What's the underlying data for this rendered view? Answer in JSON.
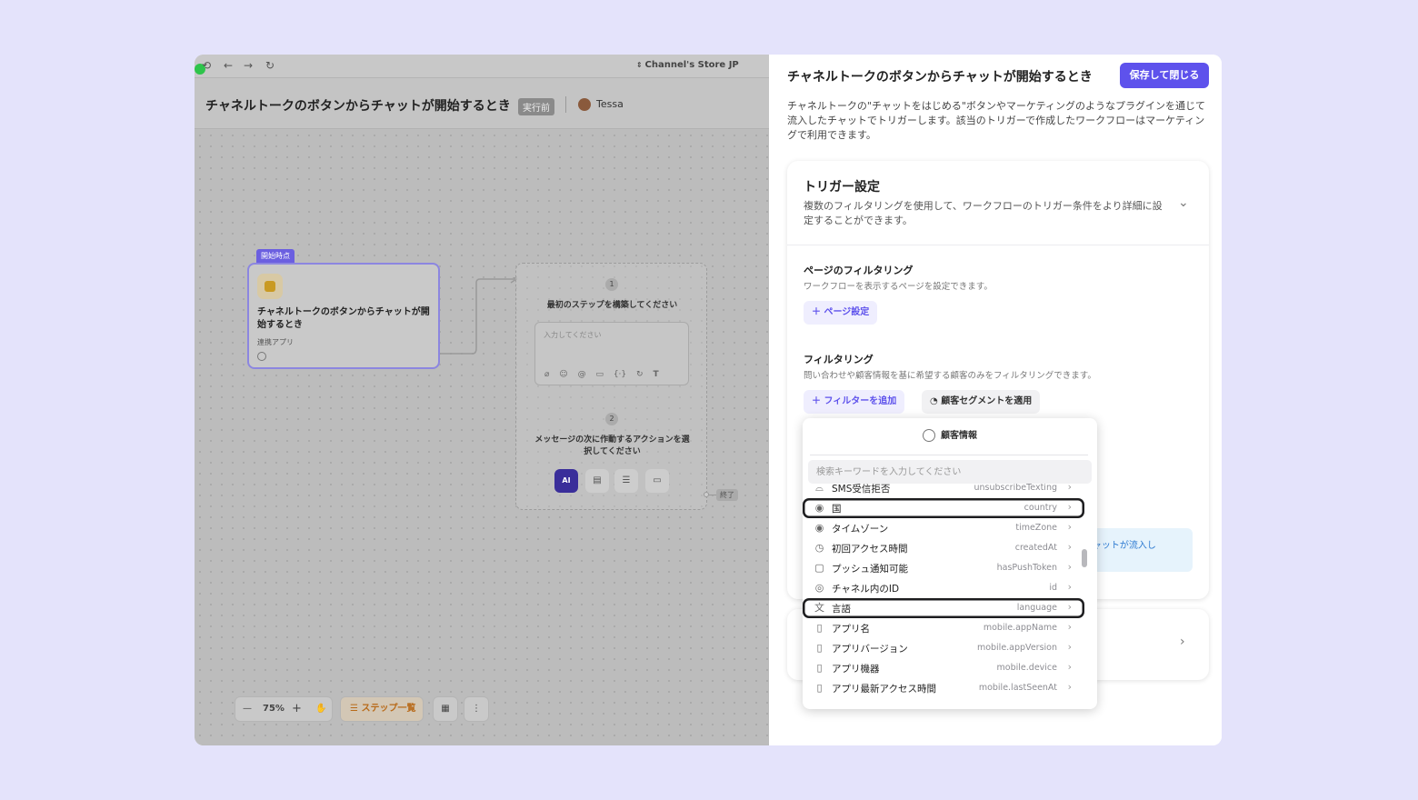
{
  "browser": {
    "store_name": "Channel's Store JP"
  },
  "workflow": {
    "title": "チャネルトークのボタンからチャットが開始するとき",
    "status_badge": "実行前",
    "user_name": "Tessa"
  },
  "canvas": {
    "start_tag": "開始時点",
    "trigger_card": {
      "title": "チャネルトークのボタンからチャットが開始するとき",
      "subtitle": "連携アプリ"
    },
    "step1": {
      "number": "1",
      "title": "最初のステップを構築してください",
      "placeholder": "入力してください"
    },
    "step2": {
      "number": "2",
      "title": "メッセージの次に作動するアクションを選択してください",
      "ai_label": "AI"
    },
    "end_tag": "終了",
    "zoom": "75%",
    "steps_button": "ステップ一覧"
  },
  "panel": {
    "title": "チャネルトークのボタンからチャットが開始するとき",
    "save_button": "保存して閉じる",
    "description": "チャネルトークの\"チャットをはじめる\"ボタンやマーケティングのようなプラグインを通じて流入したチャットでトリガーします。該当のトリガーで作成したワークフローはマーケティングで利用できます。",
    "trigger": {
      "heading": "トリガー設定",
      "subtitle": "複数のフィルタリングを使用して、ワークフローのトリガー条件をより詳細に設定することができます。"
    },
    "page_filter": {
      "title": "ページのフィルタリング",
      "subtitle": "ワークフローを表示するページを設定できます。",
      "button": "ページ設定"
    },
    "filtering": {
      "title": "フィルタリング",
      "subtitle": "問い合わせや顧客情報を基に希望する顧客のみをフィルタリングできます。",
      "add_button": "フィルターを追加",
      "segment_button": "顧客セグメントを適用"
    },
    "info_text": "チャットが流入し"
  },
  "dropdown": {
    "header": "顧客情報",
    "search_placeholder": "検索キーワードを入力してください",
    "items": [
      {
        "label": "SMS受信拒否",
        "key": "unsubscribeTexting",
        "icon": "chat-icon"
      },
      {
        "label": "国",
        "key": "country",
        "icon": "pin-icon"
      },
      {
        "label": "タイムゾーン",
        "key": "timeZone",
        "icon": "pin-icon"
      },
      {
        "label": "初回アクセス時間",
        "key": "createdAt",
        "icon": "clock-icon"
      },
      {
        "label": "プッシュ通知可能",
        "key": "hasPushToken",
        "icon": "push-icon"
      },
      {
        "label": "チャネル内のID",
        "key": "id",
        "icon": "user-icon"
      },
      {
        "label": "言語",
        "key": "language",
        "icon": "translate-icon"
      },
      {
        "label": "アプリ名",
        "key": "mobile.appName",
        "icon": "phone-icon"
      },
      {
        "label": "アプリバージョン",
        "key": "mobile.appVersion",
        "icon": "phone-icon"
      },
      {
        "label": "アプリ機器",
        "key": "mobile.device",
        "icon": "phone-icon"
      },
      {
        "label": "アプリ最新アクセス時間",
        "key": "mobile.lastSeenAt",
        "icon": "phone-icon"
      }
    ]
  }
}
